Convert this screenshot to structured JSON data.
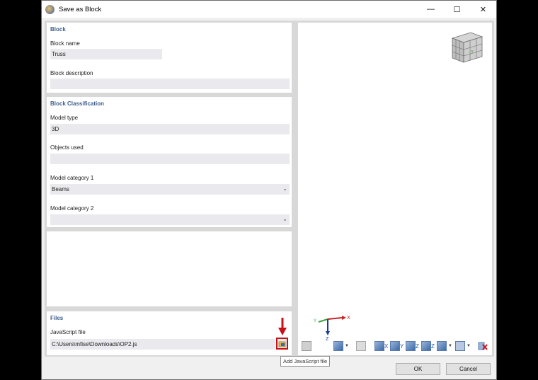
{
  "window": {
    "title": "Save as Block"
  },
  "block": {
    "section_title": "Block",
    "name_label": "Block name",
    "name_value": "Truss",
    "description_label": "Block description",
    "description_value": ""
  },
  "classification": {
    "section_title": "Block Classification",
    "model_type_label": "Model type",
    "model_type_value": "3D",
    "objects_label": "Objects used",
    "objects_value": "",
    "category1_label": "Model category 1",
    "category1_value": "Beams",
    "category2_label": "Model category 2",
    "category2_value": ""
  },
  "files": {
    "section_title": "Files",
    "js_label": "JavaScript file",
    "js_value": "C:\\Users\\mfise\\Downloads\\OP2.js",
    "add_js_tooltip": "Add JavaScript file"
  },
  "preview": {
    "axis_x": "X",
    "axis_y": "Y",
    "axis_z": "Z",
    "toolbar_labels": [
      "X",
      "Y",
      "Z",
      "Z"
    ]
  },
  "footer": {
    "ok_label": "OK",
    "cancel_label": "Cancel"
  },
  "colors": {
    "section_title": "#3d5f8f",
    "highlight": "#c8101a"
  }
}
